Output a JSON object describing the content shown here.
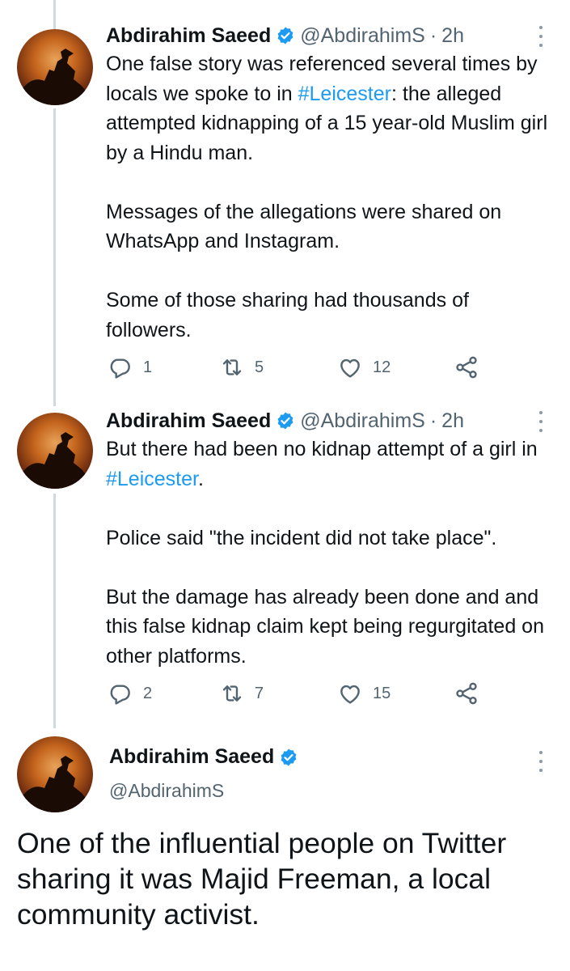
{
  "tweets": [
    {
      "author_name": "Abdirahim Saeed",
      "handle": "@AbdirahimS",
      "separator": "·",
      "time": "2h",
      "paragraphs": [
        [
          {
            "text": "One false story was referenced several times by locals we spoke to in "
          },
          {
            "text": "#Leicester",
            "hashtag": true
          },
          {
            "text": ": the alleged attempted kidnapping of a 15 year-old Muslim girl by a Hindu man."
          }
        ],
        [
          {
            "text": "Messages of the allegations were shared on WhatsApp and Instagram."
          }
        ],
        [
          {
            "text": "Some of those sharing had thousands of followers."
          }
        ]
      ],
      "replies": "1",
      "retweets": "5",
      "likes": "12"
    },
    {
      "author_name": "Abdirahim Saeed",
      "handle": "@AbdirahimS",
      "separator": "·",
      "time": "2h",
      "paragraphs": [
        [
          {
            "text": "But there had been no kidnap attempt of a girl in "
          },
          {
            "text": "#Leicester",
            "hashtag": true
          },
          {
            "text": "."
          }
        ],
        [
          {
            "text": "Police said \"the incident did not take place\"."
          }
        ],
        [
          {
            "text": "But the damage has already been done and and this false kidnap claim kept being regurgitated on other platforms."
          }
        ]
      ],
      "replies": "2",
      "retweets": "7",
      "likes": "15"
    }
  ],
  "focused_tweet": {
    "author_name": "Abdirahim Saeed",
    "handle": "@AbdirahimS",
    "text": "One of the influential people on Twitter sharing it was Majid Freeman, a local community activist."
  },
  "icons": {
    "verified": "verified-badge-icon",
    "more": "more-options-icon",
    "reply": "reply-icon",
    "retweet": "retweet-icon",
    "like": "like-icon",
    "share": "share-icon"
  },
  "colors": {
    "link": "#1d9bf0",
    "secondary_text": "#536471",
    "thread_line": "#cfd9de",
    "verified": "#1d9bf0"
  }
}
